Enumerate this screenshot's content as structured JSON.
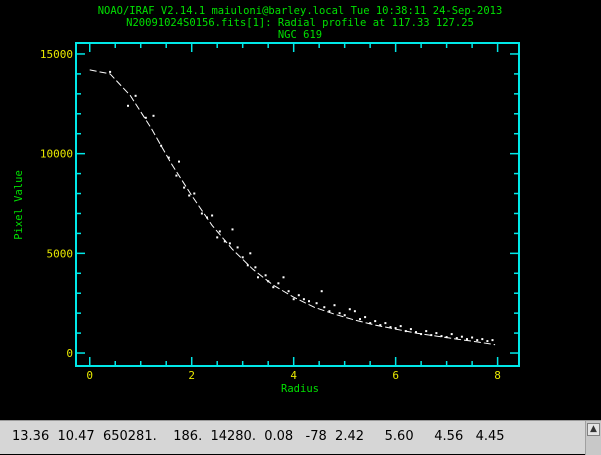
{
  "header": {
    "line1": "NOAO/IRAF V2.14.1 maiuloni@barley.local Tue 10:38:11 24-Sep-2013",
    "line2": "N20091024S0156.fits[1]: Radial profile at 117.33 127.25",
    "line3": "NGC 619"
  },
  "chart_data": {
    "type": "scatter",
    "xlabel": "Radius",
    "ylabel": "Pixel Value",
    "xlim": [
      -0.25,
      8.4
    ],
    "ylim": [
      -600,
      15500
    ],
    "xticks": [
      0,
      2,
      4,
      6,
      8
    ],
    "yticks": [
      0,
      5000,
      10000,
      15000
    ],
    "x_tick_labels": [
      "0",
      "2",
      "4",
      "6",
      "8"
    ],
    "y_tick_labels": [
      "0",
      "5000",
      "10000",
      "15000"
    ],
    "fit_curve": {
      "x": [
        0,
        0.4,
        0.8,
        1.2,
        1.6,
        2.0,
        2.4,
        2.8,
        3.2,
        3.6,
        4.0,
        4.4,
        4.8,
        5.2,
        5.6,
        6.0,
        6.4,
        6.8,
        7.2,
        7.6,
        7.95
      ],
      "y": [
        14200,
        14000,
        12900,
        11300,
        9500,
        7900,
        6400,
        5200,
        4200,
        3400,
        2800,
        2300,
        1950,
        1650,
        1400,
        1200,
        1000,
        850,
        700,
        560,
        420
      ]
    },
    "points": {
      "x": [
        0.4,
        0.75,
        0.9,
        1.1,
        1.25,
        1.4,
        1.55,
        1.7,
        1.75,
        1.85,
        1.95,
        2.05,
        2.2,
        2.3,
        2.4,
        2.5,
        2.55,
        2.65,
        2.75,
        2.8,
        2.9,
        3.0,
        3.1,
        3.15,
        3.25,
        3.3,
        3.45,
        3.5,
        3.6,
        3.7,
        3.8,
        3.9,
        4.0,
        4.1,
        4.2,
        4.3,
        4.45,
        4.55,
        4.6,
        4.7,
        4.8,
        4.9,
        5.0,
        5.1,
        5.2,
        5.3,
        5.4,
        5.5,
        5.6,
        5.7,
        5.8,
        5.9,
        6.0,
        6.1,
        6.2,
        6.3,
        6.4,
        6.5,
        6.6,
        6.7,
        6.8,
        6.9,
        7.0,
        7.1,
        7.2,
        7.3,
        7.4,
        7.5,
        7.6,
        7.7,
        7.8,
        7.9
      ],
      "y": [
        14100,
        12400,
        12900,
        11800,
        11900,
        10400,
        9800,
        8900,
        9600,
        8300,
        7900,
        8000,
        7000,
        6800,
        6900,
        5800,
        6100,
        5600,
        5500,
        6200,
        5300,
        4800,
        4400,
        5000,
        4300,
        3800,
        3900,
        3600,
        3300,
        3500,
        3800,
        3100,
        2700,
        2900,
        2700,
        2600,
        2500,
        3100,
        2300,
        2100,
        2400,
        2000,
        1900,
        2200,
        2100,
        1700,
        1800,
        1500,
        1600,
        1400,
        1500,
        1300,
        1250,
        1350,
        1100,
        1200,
        1050,
        950,
        1100,
        900,
        1000,
        850,
        800,
        950,
        750,
        820,
        700,
        780,
        650,
        700,
        600,
        650
      ]
    },
    "grid": false,
    "colors": {
      "axes": "#00e8e8",
      "fit": "#ffffff",
      "points": "#ffffff",
      "header": "#00e000",
      "ticks": "#e8e800"
    }
  },
  "status_bar": {
    "text": "13.36  10.47  650281.    186.  14280.  0.08   -78  2.42     5.60     4.56   4.45"
  }
}
